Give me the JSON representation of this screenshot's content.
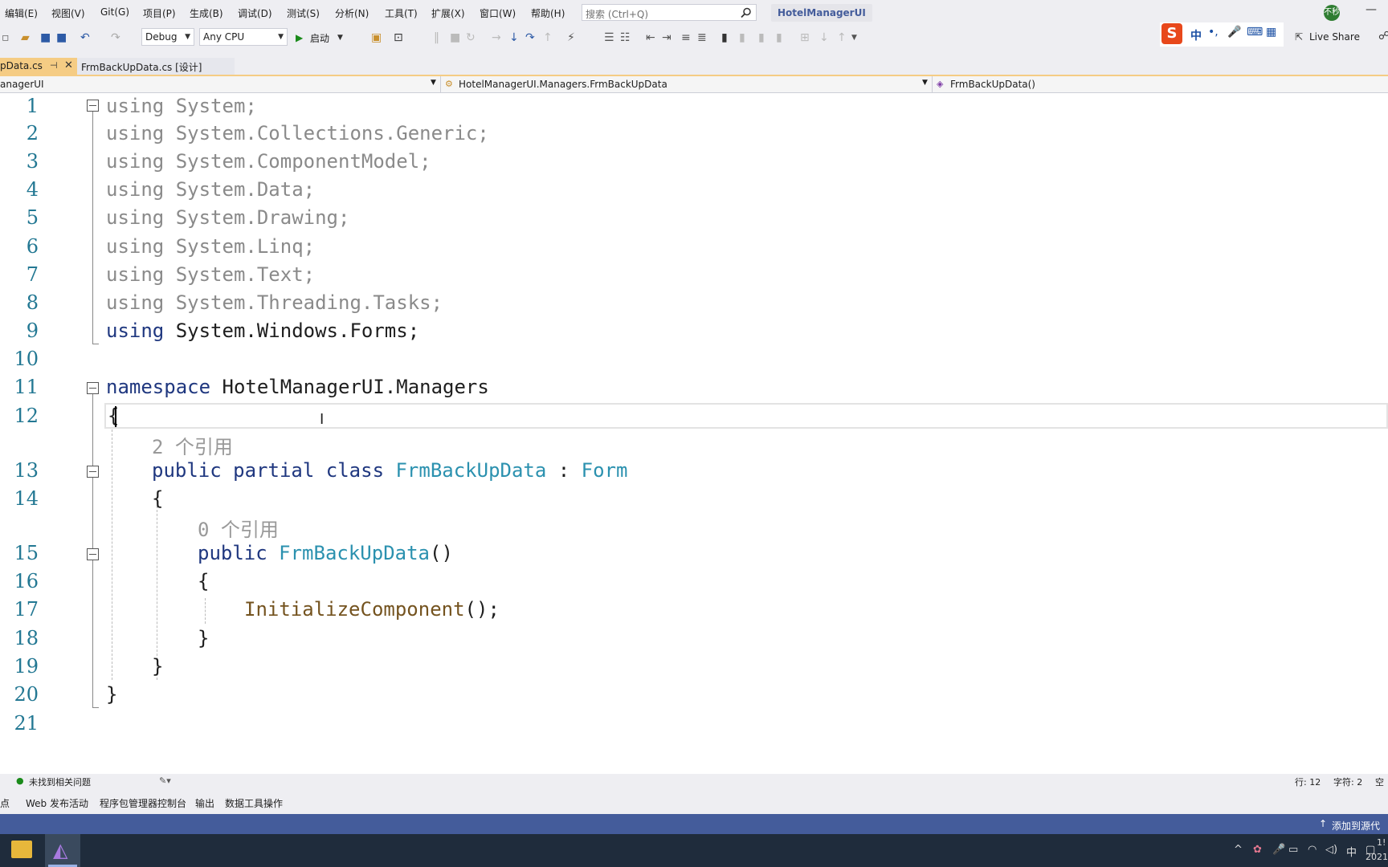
{
  "menu": {
    "items": [
      "编辑(E)",
      "视图(V)",
      "Git(G)",
      "项目(P)",
      "生成(B)",
      "调试(D)",
      "测试(S)",
      "分析(N)",
      "工具(T)",
      "扩展(X)",
      "窗口(W)",
      "帮助(H)"
    ],
    "search_placeholder": "搜索 (Ctrl+Q)",
    "solution_title": "HotelManagerUI",
    "avatar_text": "不秒"
  },
  "toolbar": {
    "config": "Debug",
    "platform": "Any CPU",
    "start_label": "启动",
    "ime_label": "中",
    "live_share": "Live Share"
  },
  "tabs": {
    "active": "pData.cs",
    "active_pin": "⊣",
    "second": "FrmBackUpData.cs [设计]"
  },
  "navbar": {
    "project": "anagerUI",
    "class": "HotelManagerUI.Managers.FrmBackUpData",
    "member": "FrmBackUpData()"
  },
  "code": {
    "line_numbers": [
      "1",
      "2",
      "3",
      "4",
      "5",
      "6",
      "7",
      "8",
      "9",
      "10",
      "11",
      "12",
      "13",
      "14",
      "15",
      "16",
      "17",
      "18",
      "19",
      "20",
      "21"
    ],
    "using_kw": "using",
    "usings": [
      "System;",
      "System.Collections.Generic;",
      "System.ComponentModel;",
      "System.Data;",
      "System.Drawing;",
      "System.Linq;",
      "System.Text;",
      "System.Threading.Tasks;",
      "System.Windows.Forms;"
    ],
    "namespace_kw": "namespace",
    "namespace_name": "HotelManagerUI.Managers",
    "open_brace": "{",
    "close_brace": "}",
    "refs_class": "2 个引用",
    "public_kw": "public",
    "partial_kw": "partial",
    "class_kw": "class",
    "class_name": "FrmBackUpData",
    "colon": ":",
    "base_class": "Form",
    "refs_ctor": "0 个引用",
    "ctor_name": "FrmBackUpData",
    "parens": "()",
    "call_name": "InitializeComponent",
    "call_suffix": "();"
  },
  "editor_status": {
    "issues": "未找到相关问题",
    "line": "行: 12",
    "col": "字符: 2",
    "space": "空格"
  },
  "bottom_tabs": [
    "断点",
    "Web 发布活动",
    "程序包管理器控制台",
    "输出",
    "数据工具操作"
  ],
  "statusbar": {
    "source_control": "添加到源代码"
  },
  "taskbar": {
    "ime": "中",
    "clock_time": "1!",
    "clock_date": "2021"
  }
}
